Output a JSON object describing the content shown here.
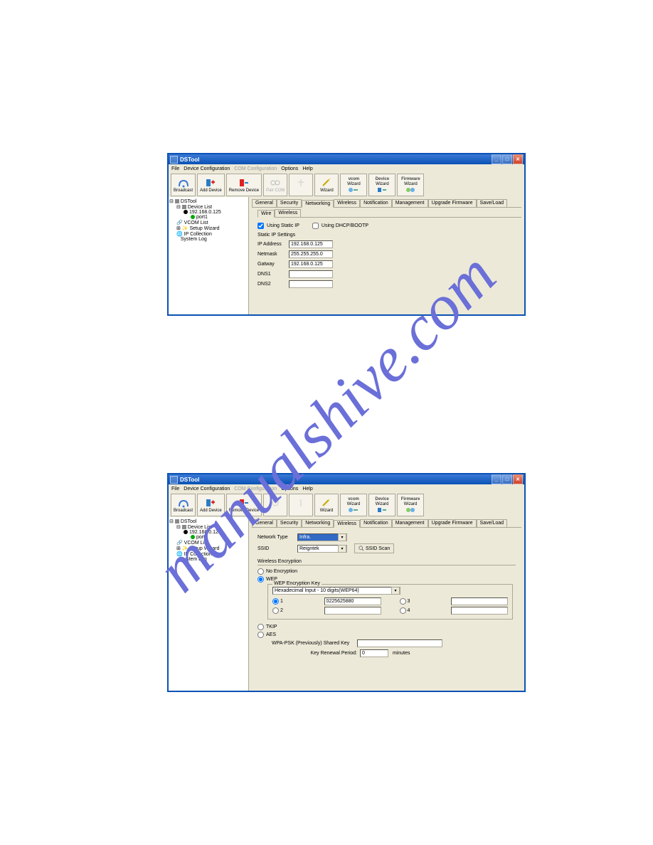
{
  "watermark": "manualshive.com",
  "window1": {
    "title": "DSTool",
    "menu": [
      "File",
      "Device Configuration",
      "COM Configuration",
      "Options",
      "Help"
    ],
    "toolbar": {
      "broadcast": "Broadcast",
      "add_device": "Add Device",
      "remove_device": "Remove Device",
      "pair_com": "Pair COM",
      "wizard": "Wizard",
      "vcom_wizard_top": "vcom",
      "vcom_wizard_bot": "Wizard",
      "device_wizard_top": "Device",
      "device_wizard_bot": "Wizard",
      "firmware_wizard_top": "Firmware",
      "firmware_wizard_bot": "Wizard"
    },
    "tree": {
      "root": "DSTool",
      "device_list": "Device List",
      "ip": "192.168.0.125",
      "port": "port1",
      "vcom_list": "VCOM List",
      "setup_wizard": "Setup Wizard",
      "ip_collection": "IP Collection",
      "system_log": "System Log"
    },
    "tabs": [
      "General",
      "Security",
      "Networking",
      "Wireless",
      "Notification",
      "Management",
      "Upgrade Firmware",
      "Save/Load"
    ],
    "active_tab": "Networking",
    "subtabs": [
      "Wire",
      "Wireless"
    ],
    "active_subtab": "Wire",
    "static_ip_cb": "Using Static IP",
    "dhcp_cb": "Using DHCP/BOOTP",
    "group_label": "Static IP Settings",
    "fields": {
      "ip_label": "IP Address",
      "ip_value": "192.168.0.125",
      "netmask_label": "Netmask",
      "netmask_value": "255.255.255.0",
      "gateway_label": "Gatway",
      "gateway_value": "192.168.0.125",
      "dns1_label": "DNS1",
      "dns1_value": "",
      "dns2_label": "DNS2",
      "dns2_value": ""
    }
  },
  "window2": {
    "title": "DSTool",
    "menu": [
      "File",
      "Device Configuration",
      "COM Configuration",
      "Options",
      "Help"
    ],
    "toolbar": {
      "broadcast": "Broadcast",
      "add_device": "Add Device",
      "remove_device": "Remove Device",
      "wizard": "Wizard",
      "vcom_wizard_top": "vcom",
      "vcom_wizard_bot": "Wizard",
      "device_wizard_top": "Device",
      "device_wizard_bot": "Wizard",
      "firmware_wizard_top": "Firmware",
      "firmware_wizard_bot": "Wizard"
    },
    "tree": {
      "root": "DSTool",
      "device_list": "Device List",
      "ip": "192.168.0.125",
      "port": "port1",
      "vcom_list": "VCOM List",
      "setup_wizard": "Setup Wizard",
      "ip_collection": "IP Collection",
      "system_log": "System Log"
    },
    "tabs": [
      "General",
      "Security",
      "Networking",
      "Wireless",
      "Notification",
      "Management",
      "Upgrade Firmware",
      "Save/Load"
    ],
    "active_tab": "Wireless",
    "network_type_label": "Network Type",
    "network_type_value": "Infra.",
    "ssid_label": "SSID",
    "ssid_value": "Reigntek",
    "ssid_scan": "SSID Scan",
    "encryption_header": "Wireless Encryption",
    "radios": {
      "no_encryption": "No Encryption",
      "wep": "WEP",
      "tkip": "TKIP",
      "aes": "AES"
    },
    "wep_legend": "WEP Encryption Key",
    "wep_format": "Hexadecimal Input - 10 digits(WEP64)",
    "wep_k1_label": "1",
    "wep_k1_value": "0225625880",
    "wep_k2_label": "2",
    "wep_k2_value": "",
    "wep_k3_label": "3",
    "wep_k3_value": "",
    "wep_k4_label": "4",
    "wep_k4_value": "",
    "psk_label": "WPA-PSK (Previously) Shared Key",
    "psk_value": "",
    "renewal_label": "Key Renewal Period:",
    "renewal_value": "0",
    "renewal_unit": "minutes"
  }
}
